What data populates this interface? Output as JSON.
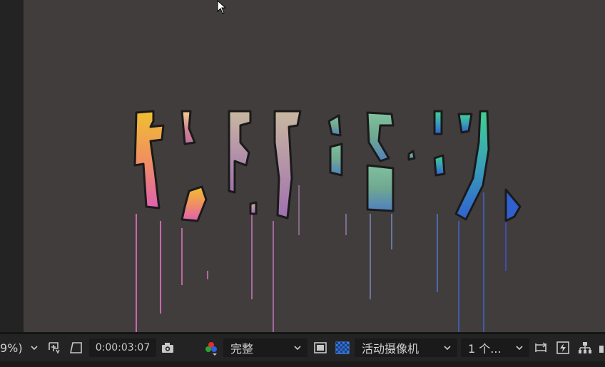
{
  "viewer": {
    "background_color": "#423d3d",
    "title_text": "形 字 语 动"
  },
  "toolbar": {
    "zoom_value": "9%)",
    "timecode": "0:00:03:07",
    "resolution_label": "完整",
    "camera_label": "活动摄像机",
    "views_label": "1 个..."
  },
  "icons": [
    "chevron-down-icon",
    "safe-zones-icon",
    "mask-outline-icon",
    "camera-snapshot-icon",
    "color-channel-icon",
    "region-of-interest-icon",
    "transparency-grid-icon",
    "reset-exposure-icon",
    "fast-preview-icon",
    "flowchart-icon",
    "mouse-cursor-icon"
  ]
}
